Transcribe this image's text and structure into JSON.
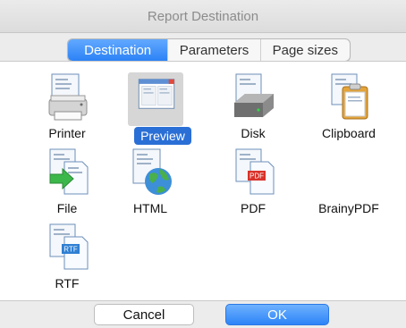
{
  "window": {
    "title": "Report Destination"
  },
  "tabs": [
    {
      "label": "Destination"
    },
    {
      "label": "Parameters"
    },
    {
      "label": "Page sizes"
    }
  ],
  "destinations": [
    {
      "label": "Printer",
      "icon": "printer-icon"
    },
    {
      "label": "Preview",
      "icon": "preview-icon"
    },
    {
      "label": "Disk",
      "icon": "disk-icon"
    },
    {
      "label": "Clipboard",
      "icon": "clipboard-icon"
    },
    {
      "label": "File",
      "icon": "file-icon"
    },
    {
      "label": "HTML",
      "icon": "html-icon"
    },
    {
      "label": "PDF",
      "icon": "pdf-icon"
    },
    {
      "label": "BrainyPDF",
      "icon": "brainypdf-icon"
    },
    {
      "label": "RTF",
      "icon": "rtf-icon"
    }
  ],
  "buttons": {
    "cancel": "Cancel",
    "ok": "OK"
  },
  "badges": {
    "pdf": "PDF",
    "rtf": "RTF"
  },
  "colors": {
    "accent": "#2c82f6",
    "selection": "#2a6fd6"
  }
}
